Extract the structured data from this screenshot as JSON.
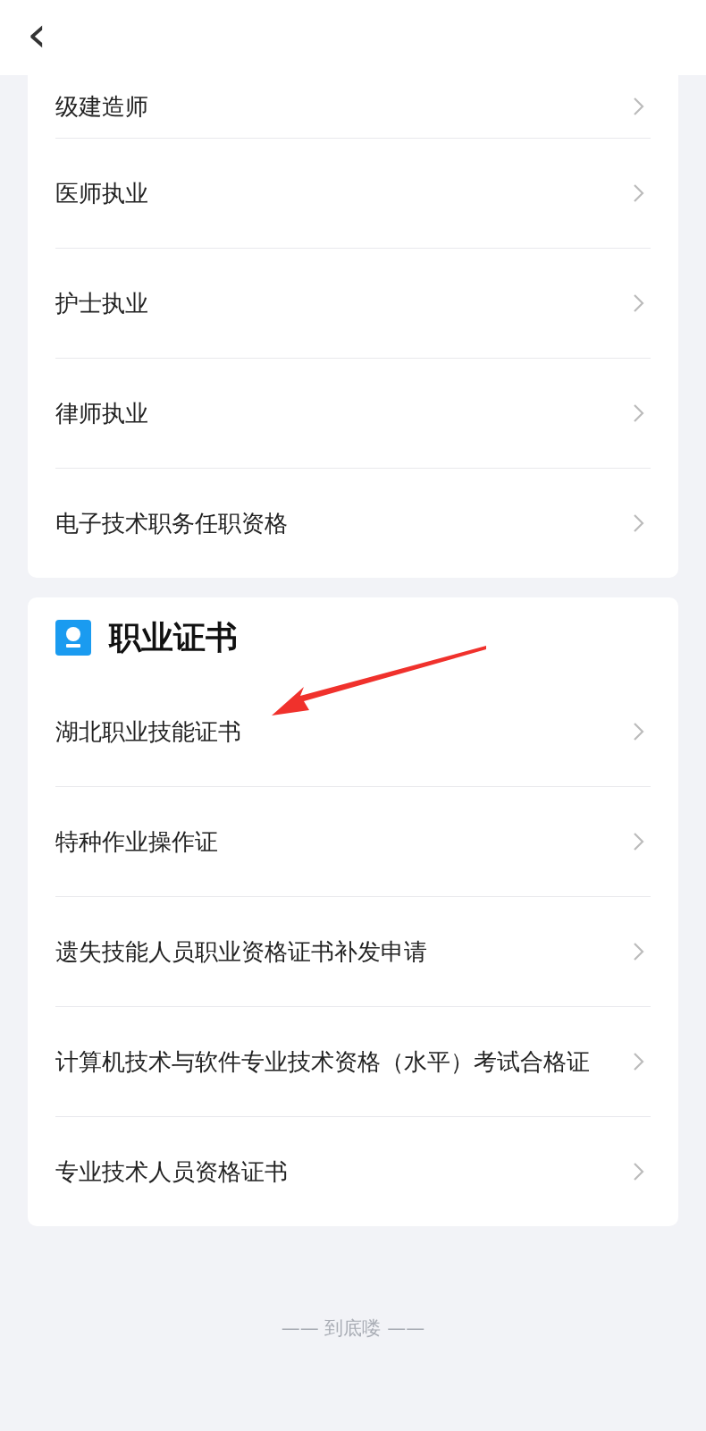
{
  "header": {
    "back": "‹"
  },
  "sections": [
    {
      "items": [
        {
          "label": "级建造师"
        },
        {
          "label": "医师执业"
        },
        {
          "label": "护士执业"
        },
        {
          "label": "律师执业"
        },
        {
          "label": "电子技术职务任职资格"
        }
      ]
    },
    {
      "title": "职业证书",
      "items": [
        {
          "label": "湖北职业技能证书"
        },
        {
          "label": "特种作业操作证"
        },
        {
          "label": "遗失技能人员职业资格证书补发申请"
        },
        {
          "label": "计算机技术与软件专业技术资格（水平）考试合格证"
        },
        {
          "label": "专业技术人员资格证书"
        }
      ]
    }
  ],
  "footer": "—— 到底喽 ——"
}
